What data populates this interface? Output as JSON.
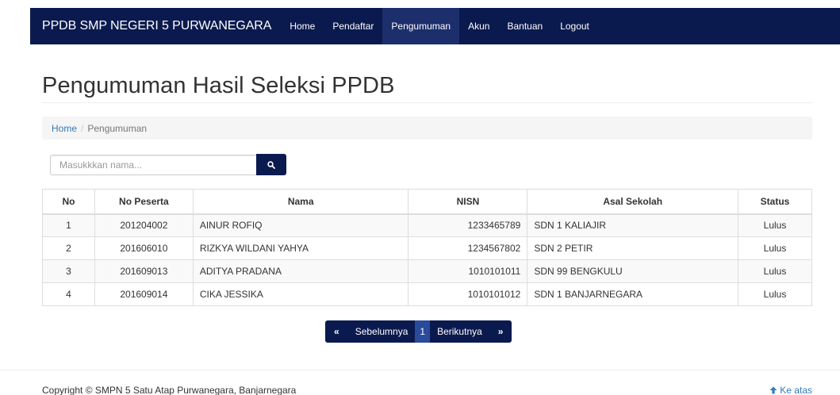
{
  "navbar": {
    "brand": "PPDB SMP NEGERI 5 PURWANEGARA",
    "items": [
      {
        "label": "Home"
      },
      {
        "label": "Pendaftar"
      },
      {
        "label": "Pengumuman",
        "active": true
      },
      {
        "label": "Akun"
      },
      {
        "label": "Bantuan"
      },
      {
        "label": "Logout"
      }
    ]
  },
  "page": {
    "title": "Pengumuman Hasil Seleksi PPDB"
  },
  "breadcrumb": {
    "home": "Home",
    "separator": "/",
    "current": "Pengumuman"
  },
  "search": {
    "placeholder": "Masukkkan nama...",
    "value": "",
    "button_icon": "search-icon"
  },
  "table": {
    "headers": [
      "No",
      "No Peserta",
      "Nama",
      "NISN",
      "Asal Sekolah",
      "Status"
    ],
    "rows": [
      [
        "1",
        "201204002",
        "AINUR ROFIQ",
        "1233465789",
        "SDN 1 KALIAJIR",
        "Lulus"
      ],
      [
        "2",
        "201606010",
        "RIZKYA WILDANI YAHYA",
        "1234567802",
        "SDN 2 PETIR",
        "Lulus"
      ],
      [
        "3",
        "201609013",
        "ADITYA PRADANA",
        "1010101011",
        "SDN 99 BENGKULU",
        "Lulus"
      ],
      [
        "4",
        "201609014",
        "CIKA JESSIKA",
        "1010101012",
        "SDN 1 BANJARNEGARA",
        "Lulus"
      ]
    ]
  },
  "pagination": {
    "first": "«",
    "prev": "Sebelumnya",
    "current": "1",
    "next": "Berikutnya",
    "last": "»"
  },
  "footer": {
    "copyright": "Copyright © SMPN 5 Satu Atap Purwanegara, Banjarnegara",
    "back_to_top": "Ke atas",
    "back_to_top_icon": "arrow-up-icon"
  },
  "colors": {
    "navbar_bg": "#0b1a4e",
    "active_nav_bg": "#1c2e6b",
    "link": "#337ab7"
  }
}
